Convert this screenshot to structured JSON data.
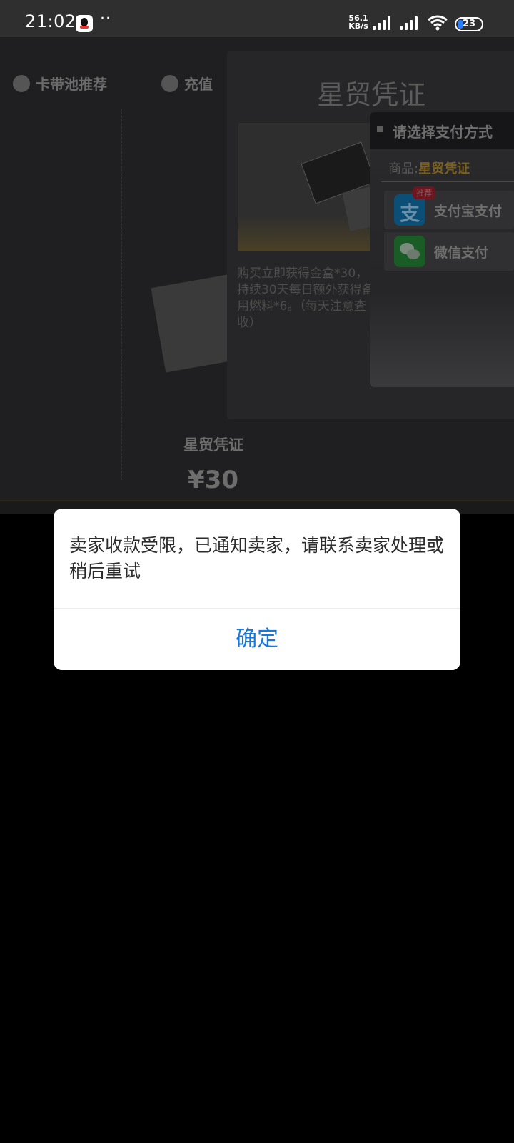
{
  "status_bar": {
    "time": "21:02",
    "more_dots": "··",
    "net_speed_value": "56.1",
    "net_speed_unit": "KB/s",
    "battery_level": "23"
  },
  "background_app": {
    "nav": {
      "tab_recommend": "卡带池推荐",
      "tab_recharge": "充值"
    },
    "left_card": {
      "title": "星贸凭证",
      "price": "¥30"
    },
    "detail": {
      "title": "星贸凭证",
      "description": "购买立即获得金盒*30，持续30天每日额外获得备用燃料*6。（每天注意查收）"
    },
    "payment_sheet": {
      "title": "请选择支付方式",
      "goods_label": "商品:",
      "goods_name": "星贸凭证",
      "options": [
        {
          "label": "支付宝支付",
          "badge": "推荐",
          "icon": "alipay-icon"
        },
        {
          "label": "微信支付",
          "icon": "wechat-icon"
        }
      ]
    }
  },
  "dialog": {
    "message": "卖家收款受限，已通知卖家，请联系卖家处理或稍后重试",
    "confirm_label": "确定"
  },
  "colors": {
    "dialog_button": "#1677dd",
    "goods_name": "#7a6021",
    "overlay": "#000000"
  }
}
